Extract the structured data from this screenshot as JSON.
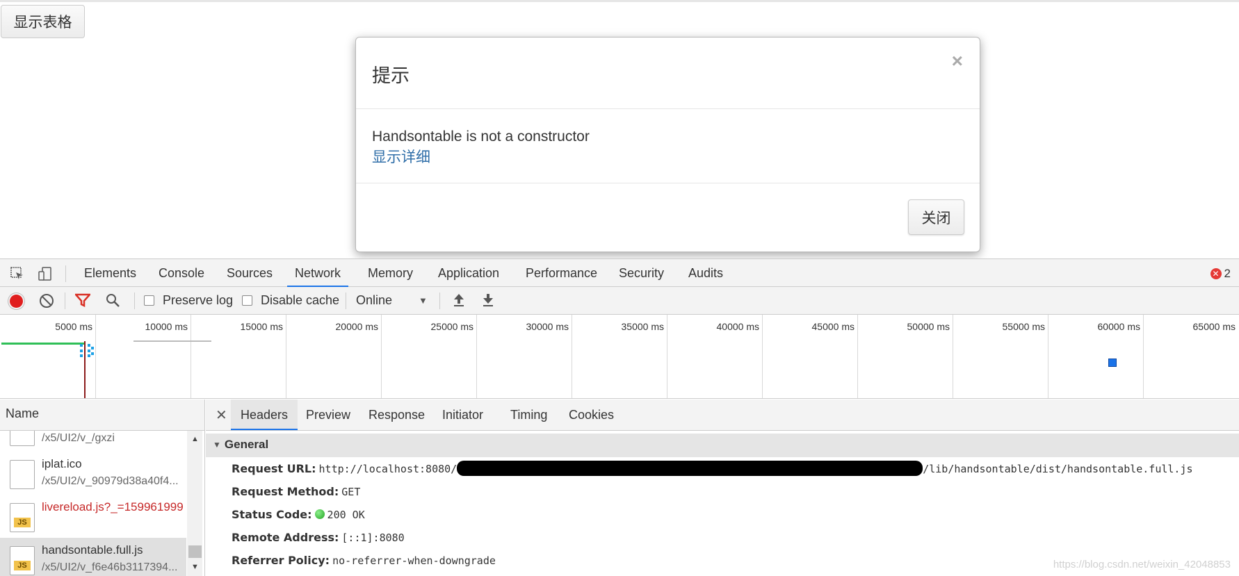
{
  "page": {
    "show_table_button": "显示表格"
  },
  "modal": {
    "title": "提示",
    "close_x": "×",
    "message": "Handsontable is not a constructor",
    "detail_link": "显示详细",
    "close_button": "关闭"
  },
  "devtools": {
    "tabs": [
      "Elements",
      "Console",
      "Sources",
      "Network",
      "Memory",
      "Application",
      "Performance",
      "Security",
      "Audits"
    ],
    "active_tab": "Network",
    "error_count": "2",
    "toolbar": {
      "preserve_log": "Preserve log",
      "disable_cache": "Disable cache",
      "throttling": "Online"
    },
    "timeline": {
      "ticks": [
        "5000 ms",
        "10000 ms",
        "15000 ms",
        "20000 ms",
        "25000 ms",
        "30000 ms",
        "35000 ms",
        "40000 ms",
        "45000 ms",
        "50000 ms",
        "55000 ms",
        "60000 ms",
        "65000 ms"
      ]
    },
    "name_column_header": "Name",
    "requests": [
      {
        "name": "",
        "path": "/x5/UI2/v_/gxzi",
        "icon": "file",
        "error": false
      },
      {
        "name": "iplat.ico",
        "path": "/x5/UI2/v_90979d38a40f4...",
        "icon": "file",
        "error": false
      },
      {
        "name": "livereload.js?_=159961999",
        "path": "",
        "icon": "js",
        "error": true
      },
      {
        "name": "handsontable.full.js",
        "path": "/x5/UI2/v_f6e46b3117394...",
        "icon": "js",
        "error": false,
        "selected": true
      }
    ],
    "detail_tabs": [
      "Headers",
      "Preview",
      "Response",
      "Initiator",
      "Timing",
      "Cookies"
    ],
    "active_detail_tab": "Headers",
    "general": {
      "section_title": "General",
      "request_url_label": "Request URL:",
      "request_url_prefix": "http://localhost:8080/",
      "request_url_suffix": "/lib/handsontable/dist/handsontable.full.js",
      "request_method_label": "Request Method:",
      "request_method": "GET",
      "status_code_label": "Status Code:",
      "status_code": "200 OK",
      "remote_address_label": "Remote Address:",
      "remote_address": "[::1]:8080",
      "referrer_policy_label": "Referrer Policy:",
      "referrer_policy": "no-referrer-when-downgrade"
    }
  },
  "watermark": "https://blog.csdn.net/weixin_42048853",
  "colors": {
    "accent": "#1a73e8",
    "record": "#e01e1e",
    "error_text": "#c62828",
    "link": "#2f6ea8",
    "status_ok": "#1fa31f"
  }
}
